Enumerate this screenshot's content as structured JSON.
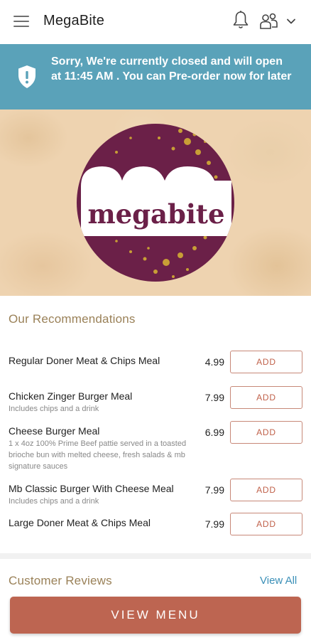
{
  "appbar": {
    "title": "MegaBite",
    "icons": [
      "menu-icon",
      "bell-icon",
      "users-icon",
      "chevron-down-icon"
    ]
  },
  "banner": {
    "message": "Sorry, We're currently closed and will open at 11:45 AM . You can Pre-order now for later",
    "icon": "shield-alert-icon",
    "color": "#5aa2b9"
  },
  "hero": {
    "logo_text_part1": "mega",
    "logo_text_part2": "bite"
  },
  "recommendations": {
    "title": "Our Recommendations",
    "items": [
      {
        "name": "Regular Doner Meat & Chips Meal",
        "description": "",
        "price": "4.99",
        "button": "ADD"
      },
      {
        "name": "Chicken Zinger Burger Meal",
        "description": "Includes chips and a drink",
        "price": "7.99",
        "button": "ADD"
      },
      {
        "name": "Cheese Burger Meal",
        "description": "1 x 4oz 100% Prime Beef pattie served in a toasted brioche  bun with melted cheese, fresh salads & mb signature sauces",
        "price": "6.99",
        "button": "ADD"
      },
      {
        "name": "Mb Classic Burger With Cheese Meal",
        "description": "Includes chips and a drink",
        "price": "7.99",
        "button": "ADD"
      },
      {
        "name": "Large Doner Meat & Chips Meal",
        "description": "",
        "price": "7.99",
        "button": "ADD"
      }
    ]
  },
  "reviews": {
    "title": "Customer Reviews",
    "view_all": "View All"
  },
  "footer": {
    "view_menu_label": "VIEW MENU",
    "button_color": "#bd6551"
  }
}
